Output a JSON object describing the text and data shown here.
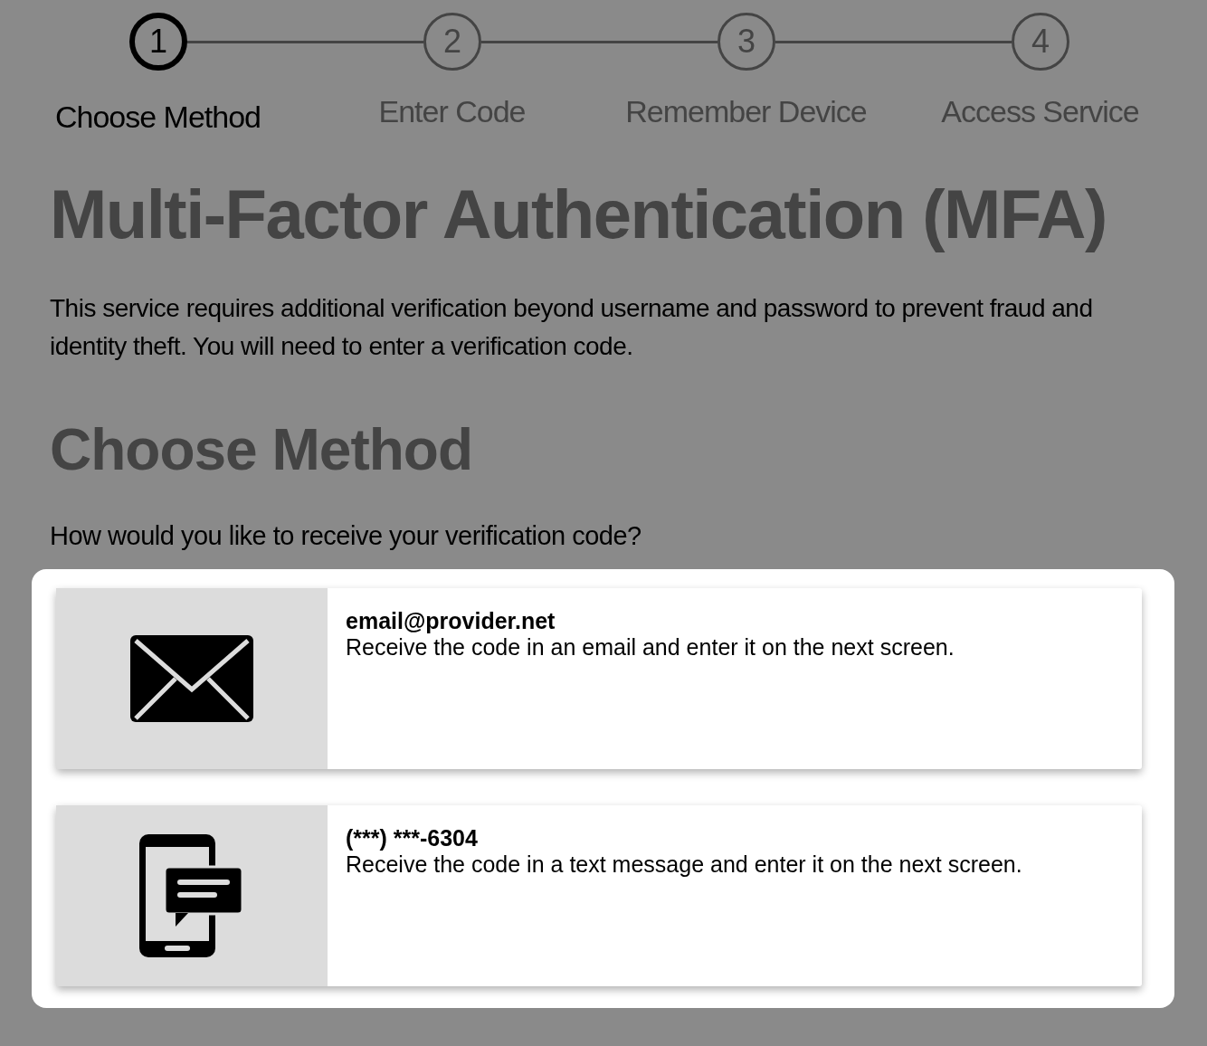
{
  "steps": [
    {
      "number": "1",
      "label": "Choose Method",
      "selected": true
    },
    {
      "number": "2",
      "label": "Enter Code",
      "selected": false
    },
    {
      "number": "3",
      "label": "Remember Device",
      "selected": false
    },
    {
      "number": "4",
      "label": "Access Service",
      "selected": false
    }
  ],
  "title": "Multi-Factor Authentication (MFA)",
  "description": "This service requires additional verification beyond username and password to prevent fraud and identity theft. You will need to enter a verification code.",
  "section_title": "Choose Method",
  "question": "How would you like to receive your verification code?",
  "methods": [
    {
      "kind": "email",
      "contact": "email@provider.net",
      "description": "Receive the code in an email and enter it on the next screen."
    },
    {
      "kind": "sms",
      "contact": "(***) ***-6304",
      "description": "Receive the code in a text message and enter it on the next screen."
    }
  ]
}
